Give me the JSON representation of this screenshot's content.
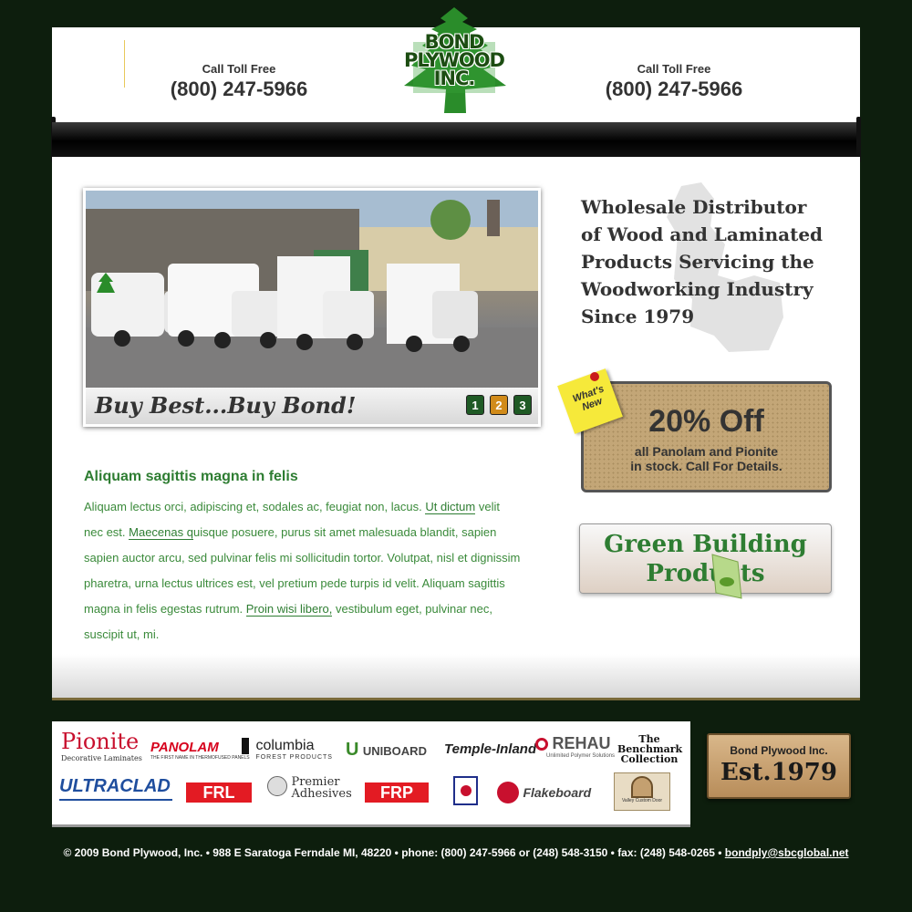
{
  "header": {
    "phone_left": {
      "label": "Call Toll Free",
      "number": "(800) 247-5966"
    },
    "phone_right": {
      "label": "Call Toll Free",
      "number": "(800) 247-5966"
    },
    "logo": {
      "line1": "BOND",
      "line2": "PLYWOOD",
      "line3": "INC."
    }
  },
  "slideshow": {
    "caption": "Buy Best...Buy Bond!",
    "pages": [
      "1",
      "2",
      "3"
    ],
    "active_page": "2"
  },
  "tagline": {
    "lines": [
      "Wholesale Distributor",
      "of Wood and Laminated",
      "Products Servicing the",
      "Woodworking Industry",
      "Since 1979"
    ]
  },
  "promo": {
    "sticky": "What's New",
    "headline": "20% Off",
    "line1": "all Panolam and Pionite",
    "line2": "in stock. Call For Details."
  },
  "green_button": {
    "line1": "Green Building",
    "line2": "Products"
  },
  "content": {
    "heading": "Aliquam sagittis magna in felis",
    "p1": "Aliquam lectus orci, adipiscing et, sodales ac, feugiat non, lacus. ",
    "link1": "Ut dictum",
    "p2": " velit nec est. ",
    "link2": "Maecenas q",
    "p3": "uisque posuere, purus sit amet malesuada blandit, sapien sapien auctor arcu, sed pulvinar felis mi sollicitudin tortor. Volutpat, nisl et dignissim pharetra, urna lectus ultrices est, vel pretium pede turpis id velit. Aliquam sagittis magna in felis egestas rutrum. ",
    "link3": "Proin wisi libero,",
    "p4": " vestibulum eget, pulvinar nec, suscipit ut, mi."
  },
  "brands": {
    "pionite": "Pionite",
    "pionite_sub": "Decorative Laminates",
    "panolam": "PANOLAM",
    "panolam_sub": "THE FIRST NAME IN THERMOFUSED PANELS",
    "columbia": "columbia",
    "columbia_sub": "FOREST PRODUCTS",
    "uniboard": "UNIBOARD",
    "temple": "Temple-Inland",
    "rehau": "REHAU",
    "rehau_sub": "Unlimited Polymer Solutions",
    "benchmark": "The Benchmark Collection",
    "ultraclad": "ULTRACLAD",
    "frl": "FRL",
    "premier": "Premier",
    "adhesives": "Adhesives",
    "frp": "FRP",
    "flakeboard": "Flakeboard",
    "valley": "Valley Custom Door"
  },
  "established": {
    "line1": "Bond Plywood Inc.",
    "line2": "Est.1979"
  },
  "footer": {
    "text": "© 2009 Bond Plywood, Inc. • 988 E Saratoga Ferndale MI, 48220 • phone: (800) 247-5966 or (248) 548-3150 •  fax: (248) 548-0265 • ",
    "email": "bondply@sbcglobal.net"
  },
  "colors": {
    "accent_green": "#2e7d32",
    "background": "#0d1e0d",
    "pager_active": "#d18b1a",
    "pager_default": "#1f5a25"
  }
}
